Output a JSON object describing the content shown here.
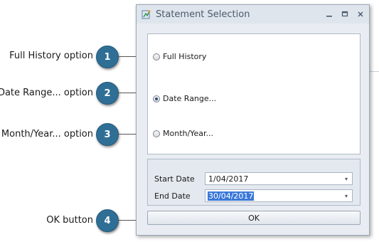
{
  "callouts": [
    {
      "number": "1",
      "label": "Full History option"
    },
    {
      "number": "2",
      "label": "Date Range... option"
    },
    {
      "number": "3",
      "label": "Month/Year... option"
    },
    {
      "number": "4",
      "label": "OK button"
    }
  ],
  "window": {
    "title": "Statement Selection",
    "icon": "statement-app-icon",
    "controls": {
      "minimize": "minimize-icon",
      "maximize": "maximize-icon",
      "close": "close-icon"
    }
  },
  "options": [
    {
      "label": "Full History",
      "checked": false
    },
    {
      "label": "Date Range...",
      "checked": true
    },
    {
      "label": "Month/Year...",
      "checked": false
    }
  ],
  "dates": {
    "start_label": "Start Date",
    "start_value": "1/04/2017",
    "end_label": "End Date",
    "end_value": "30/04/2017"
  },
  "ok_label": "OK",
  "colors": {
    "badge": "#2f6f96",
    "selection": "#3a78d8",
    "window_bg": "#e9edf3"
  }
}
